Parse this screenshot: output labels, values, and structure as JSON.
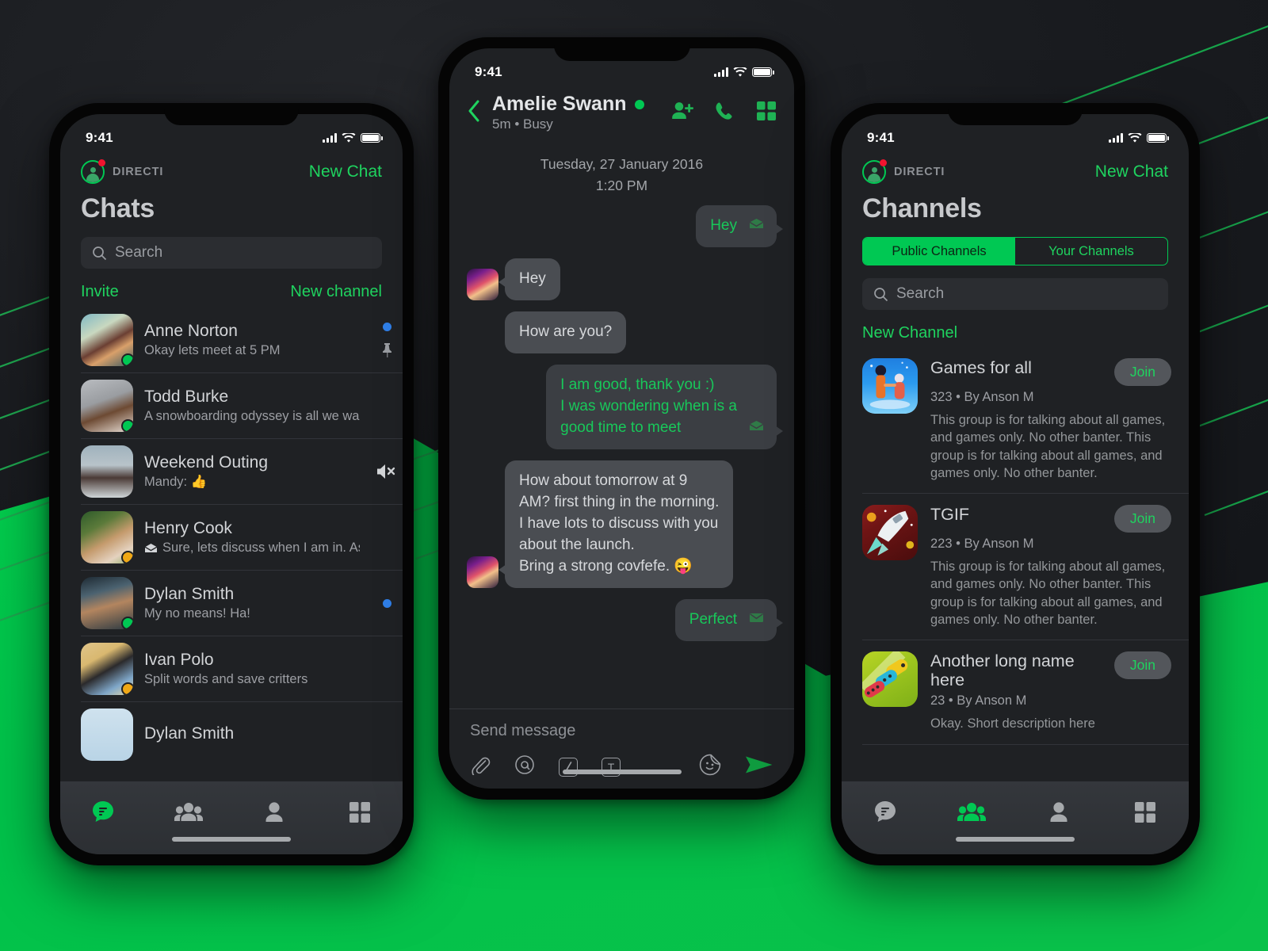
{
  "brand": {
    "name": "DIRECTI",
    "accent": "#00c853",
    "badge_color": "#f0142f"
  },
  "status_bar": {
    "time": "9:41"
  },
  "left_phone": {
    "new_chat_label": "New Chat",
    "page_title": "Chats",
    "search_placeholder": "Search",
    "invite_label": "Invite",
    "new_channel_label": "New channel",
    "chats": [
      {
        "name": "Anne Norton",
        "preview": "Okay lets meet at 5 PM",
        "presence": "online",
        "unread": true,
        "pinned": true,
        "muted": false,
        "has_envelope": false
      },
      {
        "name": "Todd Burke",
        "preview": "A snowboarding odyssey is all we want.",
        "presence": "online",
        "unread": false,
        "pinned": false,
        "muted": false,
        "has_envelope": false
      },
      {
        "name": "Weekend Outing",
        "preview": "Mandy: 👍",
        "presence": "none",
        "unread": false,
        "pinned": false,
        "muted": true,
        "has_envelope": false
      },
      {
        "name": "Henry Cook",
        "preview": "Sure, lets discuss when I am in. Ask...",
        "presence": "away",
        "unread": false,
        "pinned": false,
        "muted": false,
        "has_envelope": true
      },
      {
        "name": "Dylan Smith",
        "preview": "My no means! Ha!",
        "presence": "online",
        "unread": true,
        "pinned": false,
        "muted": false,
        "has_envelope": false
      },
      {
        "name": "Ivan Polo",
        "preview": "Split words and save critters",
        "presence": "away",
        "unread": false,
        "pinned": false,
        "muted": false,
        "has_envelope": false
      },
      {
        "name": "Dylan Smith",
        "preview": "",
        "presence": "none",
        "unread": false,
        "pinned": false,
        "muted": false,
        "has_envelope": false
      }
    ],
    "tabs": [
      {
        "icon": "chat-bubble-icon",
        "active": true
      },
      {
        "icon": "group-people-icon",
        "active": false
      },
      {
        "icon": "person-icon",
        "active": false
      },
      {
        "icon": "grid-icon",
        "active": false
      }
    ]
  },
  "center_phone": {
    "header": {
      "back_icon": "chevron-left-icon",
      "contact_name": "Amelie Swann",
      "presence_color": "#00c853",
      "status": "5m • Busy",
      "actions": [
        "add-person-icon",
        "phone-icon",
        "grid-icon"
      ]
    },
    "date_divider": "Tuesday, 27 January 2016",
    "time_divider": "1:20 PM",
    "messages": [
      {
        "dir": "out",
        "text": "Hey",
        "receipt": "envelope-open-icon",
        "avatar": false
      },
      {
        "dir": "in",
        "text": "Hey",
        "avatar": true,
        "tail": true
      },
      {
        "dir": "in",
        "text": "How are you?",
        "avatar": false,
        "tail": false
      },
      {
        "dir": "out",
        "text": "I am good, thank you :)\nI was wondering when is a\ngood time to meet",
        "receipt": "envelope-open-icon",
        "avatar": false
      },
      {
        "dir": "in",
        "text": "How about tomorrow at 9\nAM? first thing in the morning.\nI have lots to discuss with you\nabout the launch.\nBring a strong covfefe. 😜",
        "avatar": true,
        "tail": true
      },
      {
        "dir": "out",
        "text": "Perfect",
        "receipt": "envelope-closed-icon",
        "avatar": false
      }
    ],
    "composer": {
      "placeholder": "Send message",
      "tools": [
        "paperclip-icon",
        "at-mention-icon",
        "slash-command-icon",
        "text-format-icon"
      ],
      "right_tools": [
        "sticker-smiley-icon",
        "send-paper-plane-icon"
      ]
    }
  },
  "right_phone": {
    "new_chat_label": "New Chat",
    "page_title": "Channels",
    "segments": [
      {
        "label": "Public Channels",
        "active": true
      },
      {
        "label": "Your Channels",
        "active": false
      }
    ],
    "search_placeholder": "Search",
    "new_channel_label": "New Channel",
    "join_label": "Join",
    "channels": [
      {
        "name": "Games for all",
        "meta": "323 • By Anson M",
        "description": "This group is for talking about all games, and games only. No other banter. This group is for talking about all games, and games only. No other banter.",
        "icon": "monument-valley-icon"
      },
      {
        "name": "TGIF",
        "meta": "223 • By Anson M",
        "description": "This group is for talking about all games, and games only. No other banter. This group is for talking about all games, and games only. No other banter.",
        "icon": "rocket-game-icon"
      },
      {
        "name": "Another long name here",
        "meta": "23 • By Anson M",
        "description": "Okay. Short description here",
        "icon": "snake-game-icon"
      }
    ],
    "tabs": [
      {
        "icon": "chat-bubble-icon",
        "active": false
      },
      {
        "icon": "group-people-icon",
        "active": true
      },
      {
        "icon": "person-icon",
        "active": false
      },
      {
        "icon": "grid-icon",
        "active": false
      }
    ]
  }
}
